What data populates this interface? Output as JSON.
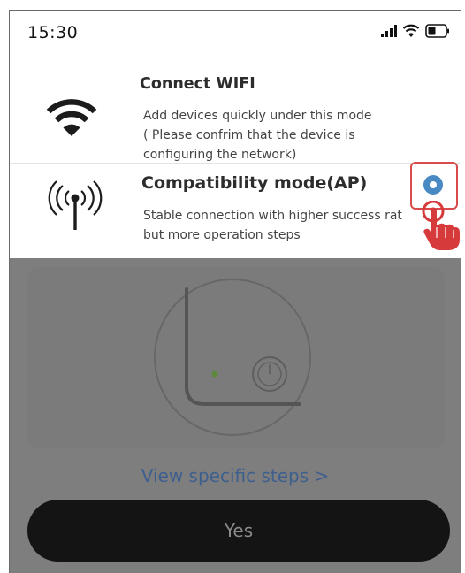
{
  "status_bar": {
    "time": "15:30",
    "icons": [
      "signal-icon",
      "wifi-status-icon",
      "battery-icon"
    ]
  },
  "modes": [
    {
      "title": "Connect WIFI",
      "description_lines": [
        "Add devices quickly under this mode",
        "( Please confrim that the device is",
        "configuring the network)"
      ],
      "icon": "wifi-icon",
      "selected": false
    },
    {
      "title": "Compatibility mode(AP)",
      "description_lines": [
        "Stable connection with higher success rat",
        "but more operation steps"
      ],
      "icon": "antenna-icon",
      "selected": true
    }
  ],
  "view_steps_link": "View specific steps >",
  "confirm_button": "Yes",
  "colors": {
    "radio_selected": "#4a8ac4",
    "highlight": "#d94a4a",
    "link": "#3e5f8e",
    "dim_overlay": "#7e7e7e",
    "button_bg": "#141414"
  }
}
